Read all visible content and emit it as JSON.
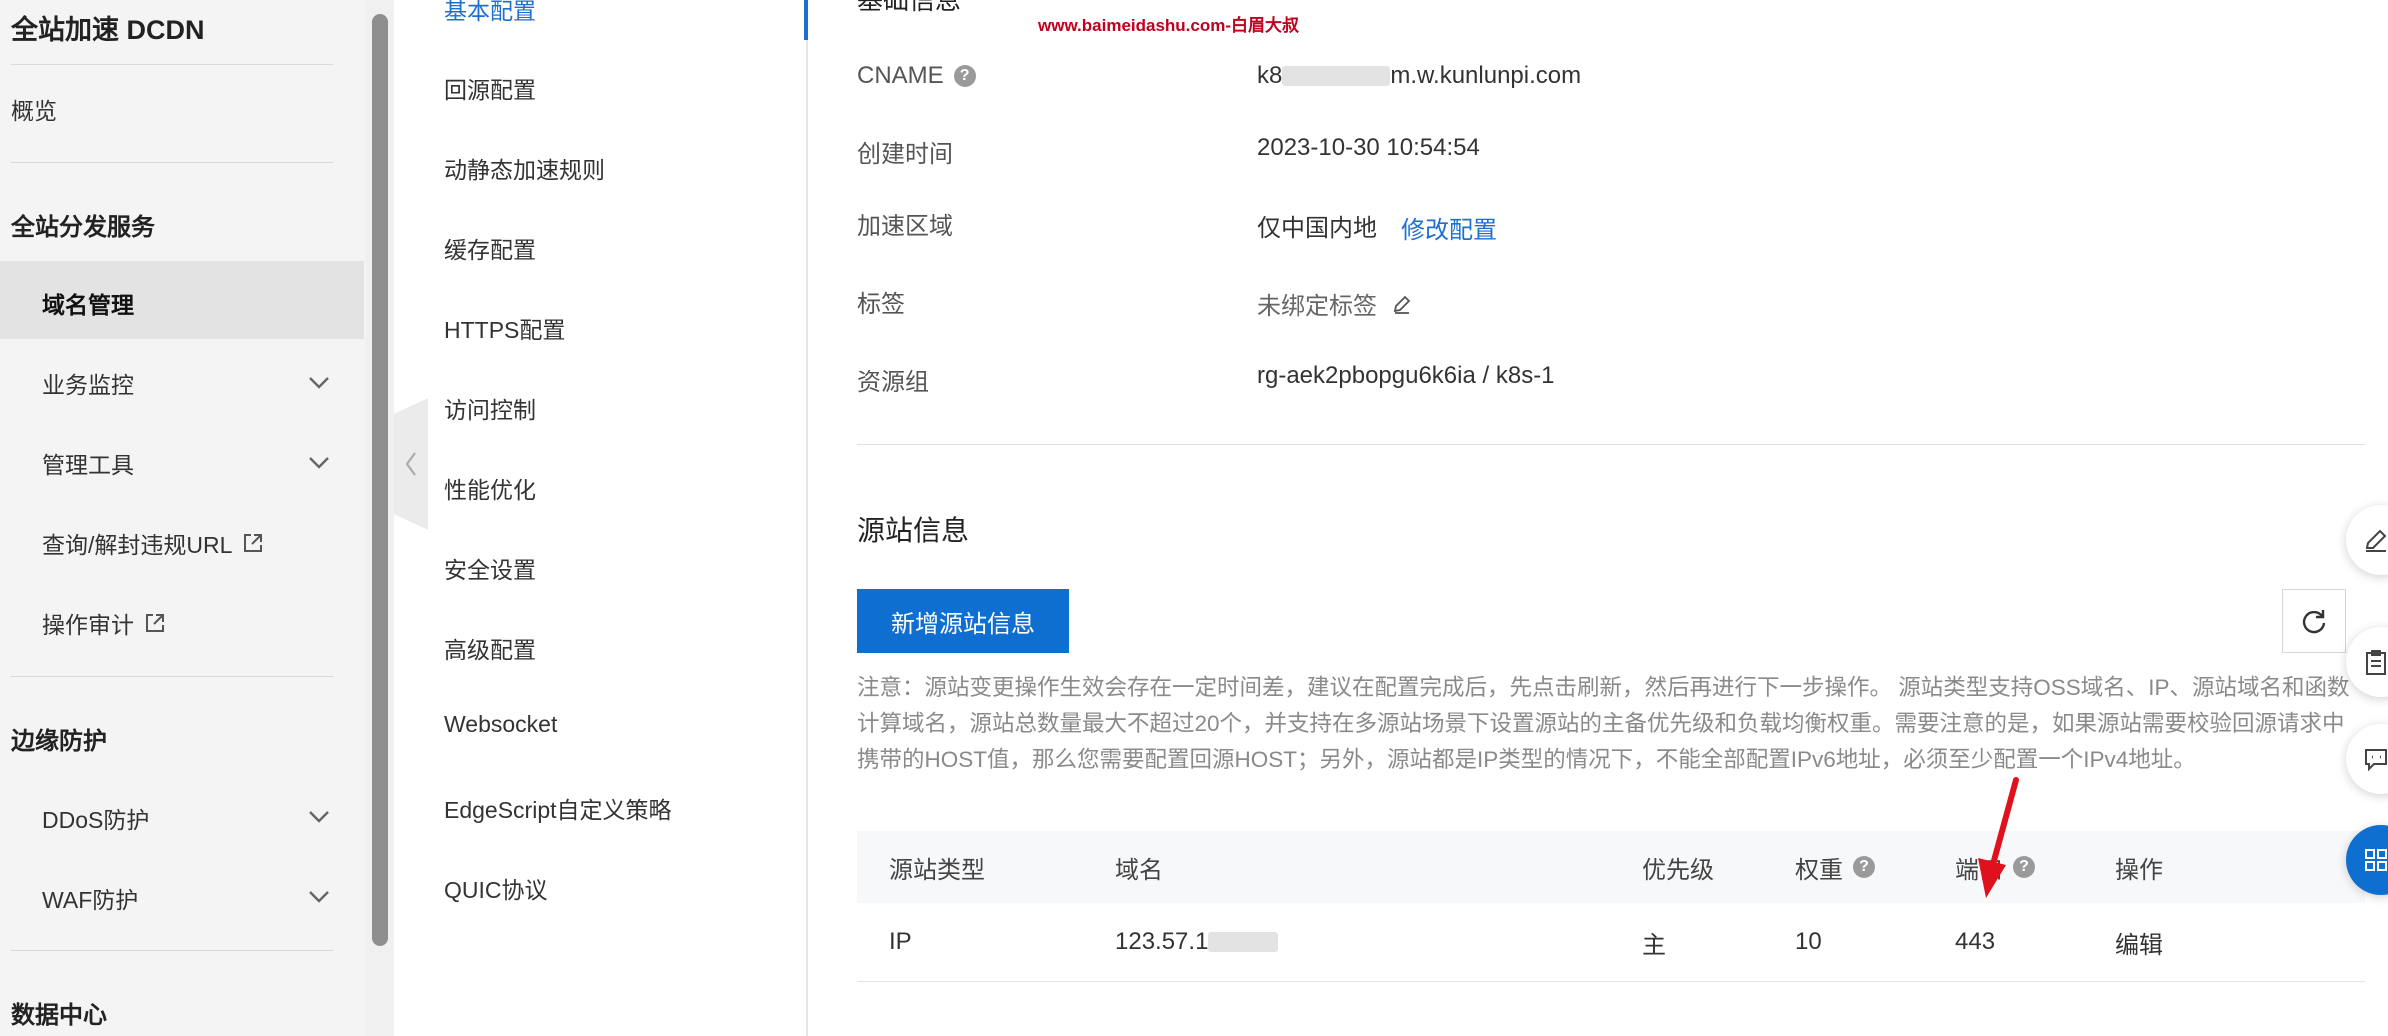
{
  "app": {
    "title": "全站加速 DCDN"
  },
  "nav": {
    "overview": "概览",
    "group1": "全站分发服务",
    "domain_mgmt": "域名管理",
    "biz_monitor": "业务监控",
    "mgmt_tools": "管理工具",
    "query_url": "查询/解封违规URL",
    "op_audit": "操作审计",
    "group2": "边缘防护",
    "ddos": "DDoS防护",
    "waf": "WAF防护",
    "group3": "数据中心"
  },
  "submenu": {
    "items": [
      "基本配置",
      "回源配置",
      "动静态加速规则",
      "缓存配置",
      "HTTPS配置",
      "访问控制",
      "性能优化",
      "安全设置",
      "高级配置",
      "Websocket",
      "EdgeScript自定义策略",
      "QUIC协议"
    ],
    "active_index": 0
  },
  "watermark": "www.baimeidashu.com-白眉大叔",
  "basic_info": {
    "section_title": "基础信息",
    "cname_label": "CNAME",
    "cname_prefix": "k8",
    "cname_suffix": "m.w.kunlunpi.com",
    "created_label": "创建时间",
    "created_value": "2023-10-30 10:54:54",
    "region_label": "加速区域",
    "region_value": "仅中国内地",
    "region_edit": "修改配置",
    "tag_label": "标签",
    "tag_value": "未绑定标签",
    "rg_label": "资源组",
    "rg_value": "rg-aek2pbopgu6k6ia / k8s-1"
  },
  "origin": {
    "section_title": "源站信息",
    "add_button": "新增源站信息",
    "note": "注意：源站变更操作生效会存在一定时间差，建议在配置完成后，先点击刷新，然后再进行下一步操作。 源站类型支持OSS域名、IP、源站域名和函数计算域名，源站总数量最大不超过20个，并支持在多源站场景下设置源站的主备优先级和负载均衡权重。需要注意的是，如果源站需要校验回源请求中携带的HOST值，那么您需要配置回源HOST；另外，源站都是IP类型的情况下，不能全部配置IPv6地址，必须至少配置一个IPv4地址。",
    "columns": [
      "源站类型",
      "域名",
      "优先级",
      "权重",
      "端口",
      "操作"
    ],
    "row": {
      "type": "IP",
      "domain_prefix": "123.57.1",
      "priority": "主",
      "weight": "10",
      "port": "443",
      "action": "编辑"
    }
  },
  "icons": {
    "collapse": "chevron-left-icon",
    "refresh": "refresh-icon",
    "help": "question-icon",
    "edit": "pencil-icon",
    "external": "external-link-icon",
    "chevron": "chevron-down-icon"
  },
  "colors": {
    "accent": "#1e6fd0",
    "button": "#0f6fd1",
    "annotation": "#e0101c"
  }
}
